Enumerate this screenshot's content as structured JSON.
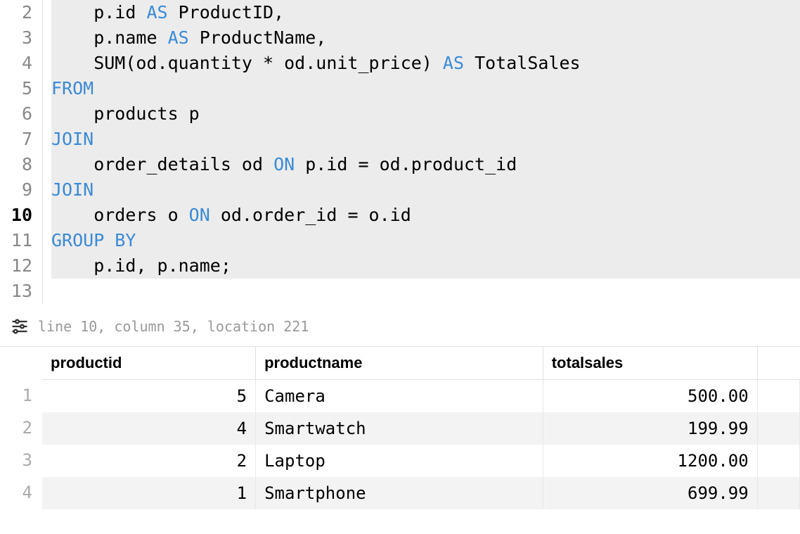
{
  "editor": {
    "lines": [
      {
        "num": 2,
        "current": false,
        "highlight": true,
        "tokens": [
          {
            "t": "    p.id "
          },
          {
            "t": "AS",
            "kw": true
          },
          {
            "t": " ProductID,"
          }
        ]
      },
      {
        "num": 3,
        "current": false,
        "highlight": true,
        "tokens": [
          {
            "t": "    p.name "
          },
          {
            "t": "AS",
            "kw": true
          },
          {
            "t": " ProductName,"
          }
        ]
      },
      {
        "num": 4,
        "current": false,
        "highlight": true,
        "tokens": [
          {
            "t": "    SUM(od.quantity * od.unit_price) "
          },
          {
            "t": "AS",
            "kw": true
          },
          {
            "t": " TotalSales"
          }
        ]
      },
      {
        "num": 5,
        "current": false,
        "highlight": true,
        "tokens": [
          {
            "t": "FROM",
            "kw": true
          }
        ]
      },
      {
        "num": 6,
        "current": false,
        "highlight": true,
        "tokens": [
          {
            "t": "    products p"
          }
        ]
      },
      {
        "num": 7,
        "current": false,
        "highlight": true,
        "tokens": [
          {
            "t": "JOIN",
            "kw": true
          }
        ]
      },
      {
        "num": 8,
        "current": false,
        "highlight": true,
        "tokens": [
          {
            "t": "    order_details od "
          },
          {
            "t": "ON",
            "kw": true
          },
          {
            "t": " p.id = od.product_id"
          }
        ]
      },
      {
        "num": 9,
        "current": false,
        "highlight": true,
        "tokens": [
          {
            "t": "JOIN",
            "kw": true
          }
        ]
      },
      {
        "num": 10,
        "current": true,
        "highlight": true,
        "tokens": [
          {
            "t": "    orders o "
          },
          {
            "t": "ON",
            "kw": true
          },
          {
            "t": " od.order_id = o.id"
          }
        ]
      },
      {
        "num": 11,
        "current": false,
        "highlight": true,
        "tokens": [
          {
            "t": "GROUP BY",
            "kw": true
          }
        ]
      },
      {
        "num": 12,
        "current": false,
        "highlight": true,
        "tokens": [
          {
            "t": "    p.id, p.name;"
          }
        ]
      },
      {
        "num": 13,
        "current": false,
        "highlight": false,
        "tokens": []
      }
    ]
  },
  "status": {
    "text": "line 10, column 35, location 221"
  },
  "results": {
    "columns": [
      "productid",
      "productname",
      "totalsales"
    ],
    "rows": [
      {
        "n": 1,
        "cells": [
          "5",
          "Camera",
          "500.00"
        ]
      },
      {
        "n": 2,
        "cells": [
          "4",
          "Smartwatch",
          "199.99"
        ]
      },
      {
        "n": 3,
        "cells": [
          "2",
          "Laptop",
          "1200.00"
        ]
      },
      {
        "n": 4,
        "cells": [
          "1",
          "Smartphone",
          "699.99"
        ]
      }
    ]
  }
}
